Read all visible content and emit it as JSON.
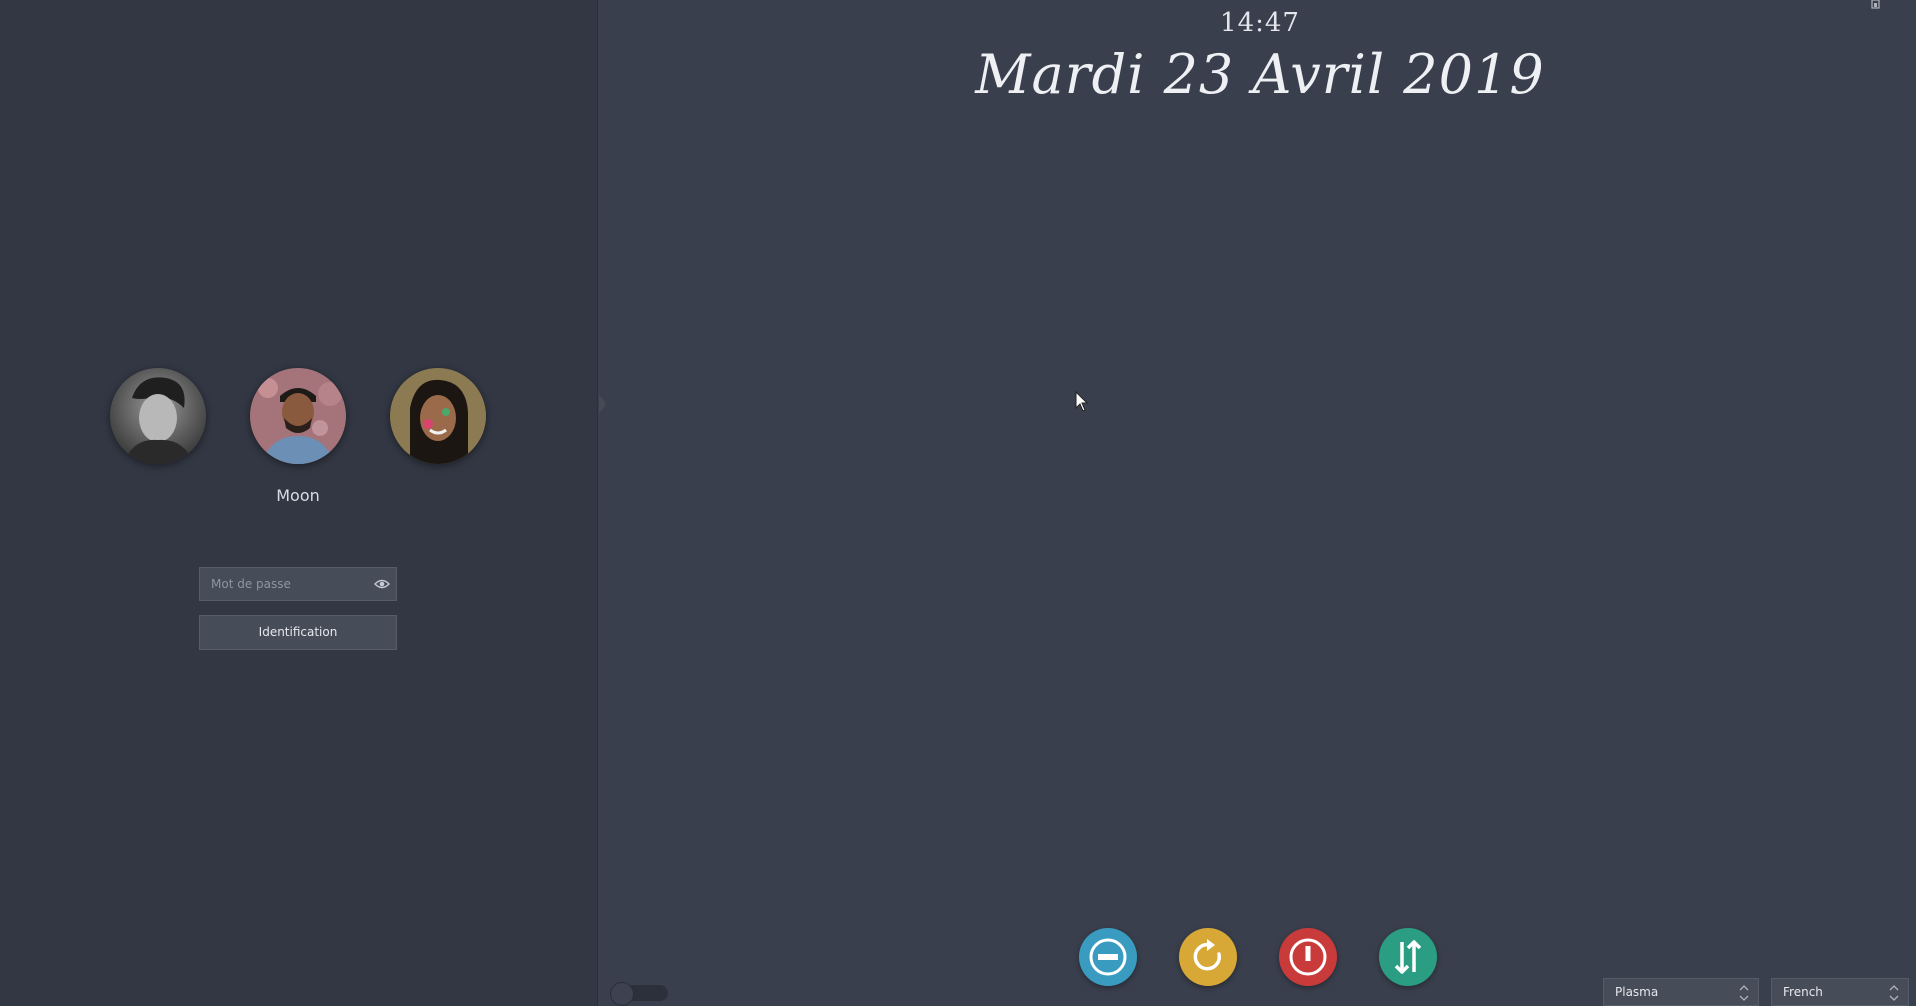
{
  "clock": {
    "time": "14:47",
    "date": "Mardi 23 Avril 2019"
  },
  "users": {
    "list": [
      {
        "label": "user-photo-1"
      },
      {
        "label": "user-photo-2"
      },
      {
        "label": "user-photo-3"
      }
    ],
    "selected_name": "Moon"
  },
  "login": {
    "password_placeholder": "Mot de passe",
    "password_value": "",
    "submit_label": "Identification"
  },
  "actions": {
    "suspend": {
      "icon": "minus-circle-icon",
      "color": "#3a9bc1"
    },
    "reboot": {
      "icon": "refresh-icon",
      "color": "#d7a836"
    },
    "shutdown": {
      "icon": "power-icon",
      "color": "#c93a3a"
    },
    "switch_user": {
      "icon": "swap-vertical-icon",
      "color": "#2a9d82"
    }
  },
  "session": {
    "selected": "Plasma"
  },
  "language": {
    "selected": "French"
  }
}
